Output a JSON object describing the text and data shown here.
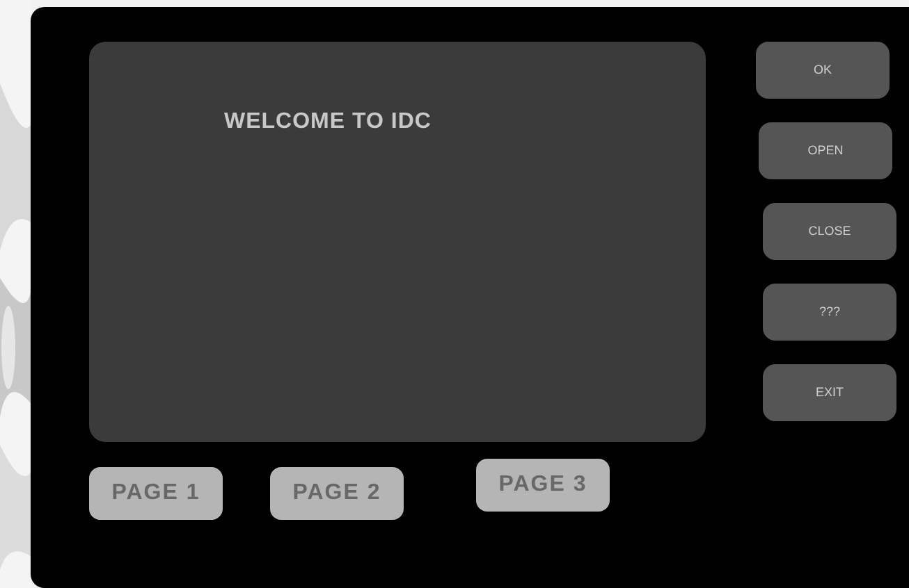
{
  "screen": {
    "message": "WELCOME TO IDC"
  },
  "side_buttons": [
    "OK",
    "OPEN",
    "CLOSE",
    "???",
    "EXIT"
  ],
  "page_buttons": [
    "PAGE 1",
    "PAGE 2",
    "PAGE 3"
  ]
}
